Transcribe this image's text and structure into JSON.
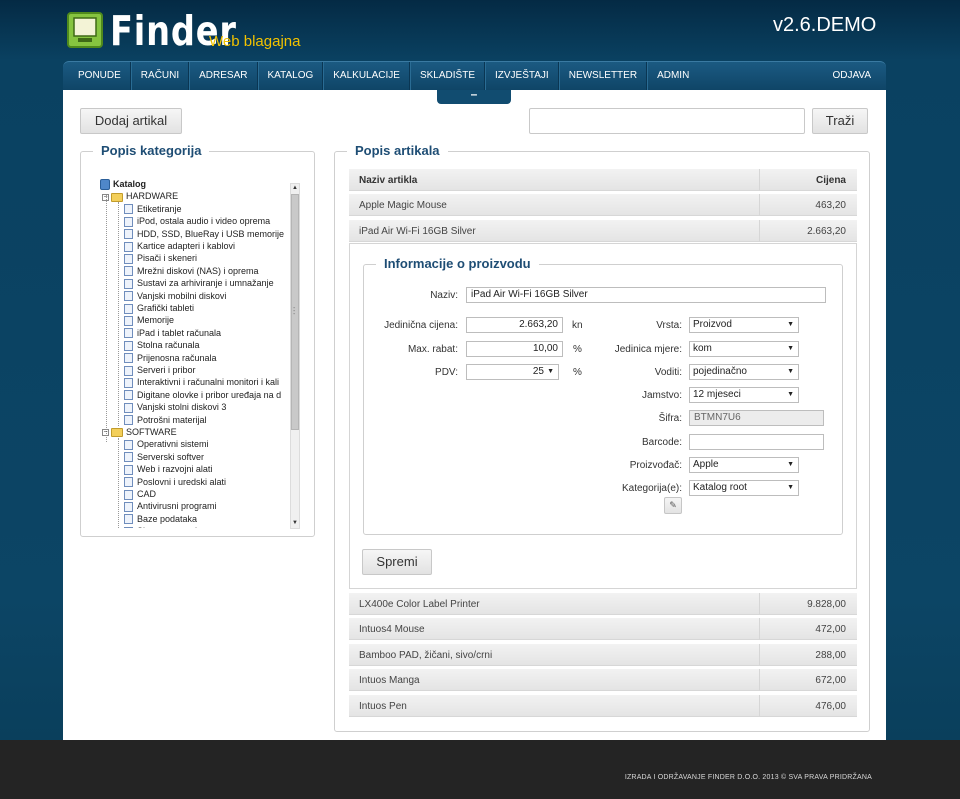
{
  "brand": {
    "name": "Finder",
    "subtitle": "Web blagajna",
    "version": "v2.6.DEMO"
  },
  "nav": {
    "items": [
      "PONUDE",
      "RAČUNI",
      "ADRESAR",
      "KATALOG",
      "KALKULACIJE",
      "SKLADIŠTE",
      "IZVJEŠTAJI",
      "NEWSLETTER",
      "ADMIN"
    ],
    "logout": "ODJAVA",
    "collapse": "–"
  },
  "toolbar": {
    "add_label": "Dodaj artikal",
    "search_value": "",
    "search_label": "Traži"
  },
  "categories": {
    "title": "Popis kategorija",
    "root": "Katalog",
    "groups": [
      {
        "name": "HARDWARE",
        "items": [
          "Etiketiranje",
          "iPod, ostala audio i video oprema",
          "HDD, SSD, BlueRay i USB memorije",
          "Kartice adapteri i kablovi",
          "Pisači i skeneri",
          "Mrežni diskovi (NAS) i oprema",
          "Sustavi za arhiviranje i umnažanje",
          "Vanjski mobilni diskovi",
          "Grafički tableti",
          "Memorije",
          "iPad i tablet računala",
          "Stolna računala",
          "Prijenosna računala",
          "Serveri i pribor",
          "Interaktivni i računalni monitori i kali",
          "Digitane olovke i pribor uređaja na d",
          "Vanjski stolni diskovi 3",
          "Potrošni materijal"
        ]
      },
      {
        "name": "SOFTWARE",
        "items": [
          "Operativni sistemi",
          "Serverski softver",
          "Web i razvojni alati",
          "Poslovni i uredski alati",
          "CAD",
          "Antivirusni programi",
          "Baze podataka",
          "Sigurnosna pohrana"
        ]
      }
    ]
  },
  "articles": {
    "title": "Popis artikala",
    "col_name": "Naziv artikla",
    "col_price": "Cijena",
    "rows_top": [
      {
        "name": "Apple Magic Mouse",
        "price": "463,20"
      },
      {
        "name": "iPad Air Wi-Fi 16GB Silver",
        "price": "2.663,20"
      }
    ],
    "rows_bottom": [
      {
        "name": "LX400e Color Label Printer",
        "price": "9.828,00"
      },
      {
        "name": "Intuos4 Mouse",
        "price": "472,00"
      },
      {
        "name": "Bamboo PAD, žičani, sivo/crni",
        "price": "288,00"
      },
      {
        "name": "Intuos Manga",
        "price": "672,00"
      },
      {
        "name": "Intuos Pen",
        "price": "476,00"
      }
    ]
  },
  "product": {
    "title": "Informacije o proizvodu",
    "naziv_label": "Naziv:",
    "naziv": "iPad Air Wi-Fi 16GB Silver",
    "cijena_label": "Jedinična cijena:",
    "cijena": "2.663,20",
    "cijena_unit": "kn",
    "rabat_label": "Max. rabat:",
    "rabat": "10,00",
    "rabat_unit": "%",
    "pdv_label": "PDV:",
    "pdv": "25",
    "pdv_unit": "%",
    "vrsta_label": "Vrsta:",
    "vrsta": "Proizvod",
    "jedinica_label": "Jedinica mjere:",
    "jedinica": "kom",
    "voditi_label": "Voditi:",
    "voditi": "pojedinačno",
    "jamstvo_label": "Jamstvo:",
    "jamstvo": "12 mjeseci",
    "sifra_label": "Šifra:",
    "sifra": "BTMN7U6",
    "barcode_label": "Barcode:",
    "barcode": "",
    "proizvodjac_label": "Proizvođač:",
    "proizvodjac": "Apple",
    "kategorija_label": "Kategorija(e):",
    "kategorija": "Katalog root",
    "save_label": "Spremi"
  },
  "footer": {
    "text": "IZRADA I ODRŽAVANJE FINDER D.O.O. 2013 © SVA PRAVA PRIDRŽANA"
  }
}
